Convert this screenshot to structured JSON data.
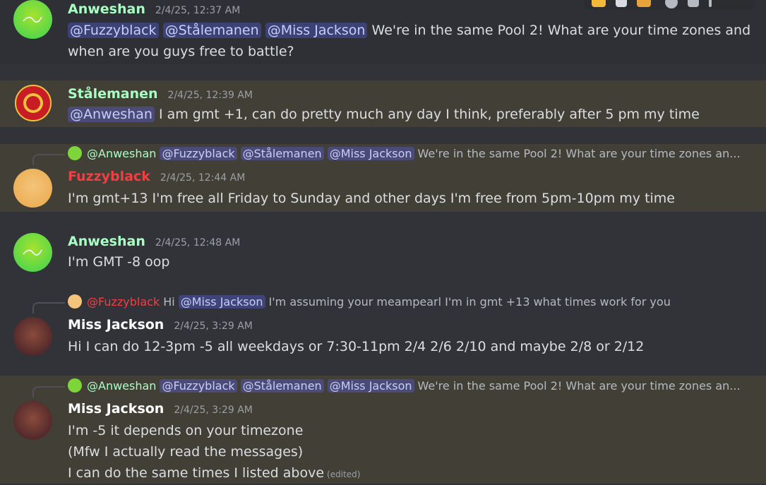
{
  "toolbar": {
    "icons": [
      "thumbs-up-emoji-icon",
      "castle-emoji-icon",
      "sticker-emoji-icon",
      "reaction-add-icon",
      "reply-icon",
      "more-icon"
    ]
  },
  "messages": [
    {
      "author": "Anweshan",
      "author_color": "#a8ffc3",
      "timestamp": "2/4/25, 12:37 AM",
      "lines": [
        {
          "mentions": [
            "@Fuzzyblack",
            "@Stålemanen",
            "@Miss Jackson"
          ],
          "text": "We're in the same Pool 2! What are your time zones and"
        },
        {
          "text": "when are you guys free to battle?"
        }
      ]
    },
    {
      "author": "Stålemanen",
      "author_color": "#a8ffc3",
      "timestamp": "2/4/25, 12:39 AM",
      "mention": "@Anweshan",
      "text": "I am gmt +1, can do pretty much any day I think, preferably after 5 pm my time"
    },
    {
      "reply": {
        "author": "@Anweshan",
        "mentions": [
          "@Fuzzyblack",
          "@Stålemanen",
          "@Miss Jackson"
        ],
        "text": "We're in the same Pool 2! What are your time zones an..."
      },
      "author": "Fuzzyblack",
      "author_color": "#f23f43",
      "timestamp": "2/4/25, 12:44 AM",
      "text": "I'm gmt+13 I'm free all Friday to Sunday and other days I'm free from 5pm-10pm my time"
    },
    {
      "author": "Anweshan",
      "author_color": "#a8ffc3",
      "timestamp": "2/4/25, 12:48 AM",
      "text": "I'm GMT -8 oop"
    },
    {
      "reply": {
        "author": "@Fuzzyblack",
        "pre": "Hi",
        "mention": "@Miss Jackson",
        "text": "I'm assuming your meampearl I'm in gmt +13 what times work for you"
      },
      "author": "Miss Jackson",
      "author_color": "#ffffff",
      "timestamp": "2/4/25, 3:29 AM",
      "text": "Hi I can do 12-3pm -5 all weekdays or 7:30-11pm 2/4 2/6 2/10 and maybe 2/8 or 2/12"
    },
    {
      "reply": {
        "author": "@Anweshan",
        "mentions": [
          "@Fuzzyblack",
          "@Stålemanen",
          "@Miss Jackson"
        ],
        "text": "We're in the same Pool 2! What are your time zones an..."
      },
      "author": "Miss Jackson",
      "author_color": "#ffffff",
      "timestamp": "2/4/25, 3:29 AM",
      "lines": [
        "I'm -5 it depends on your timezone",
        "(Mfw I actually read the messages)",
        "I can do the same times I listed above"
      ],
      "edited": "(edited)"
    }
  ]
}
